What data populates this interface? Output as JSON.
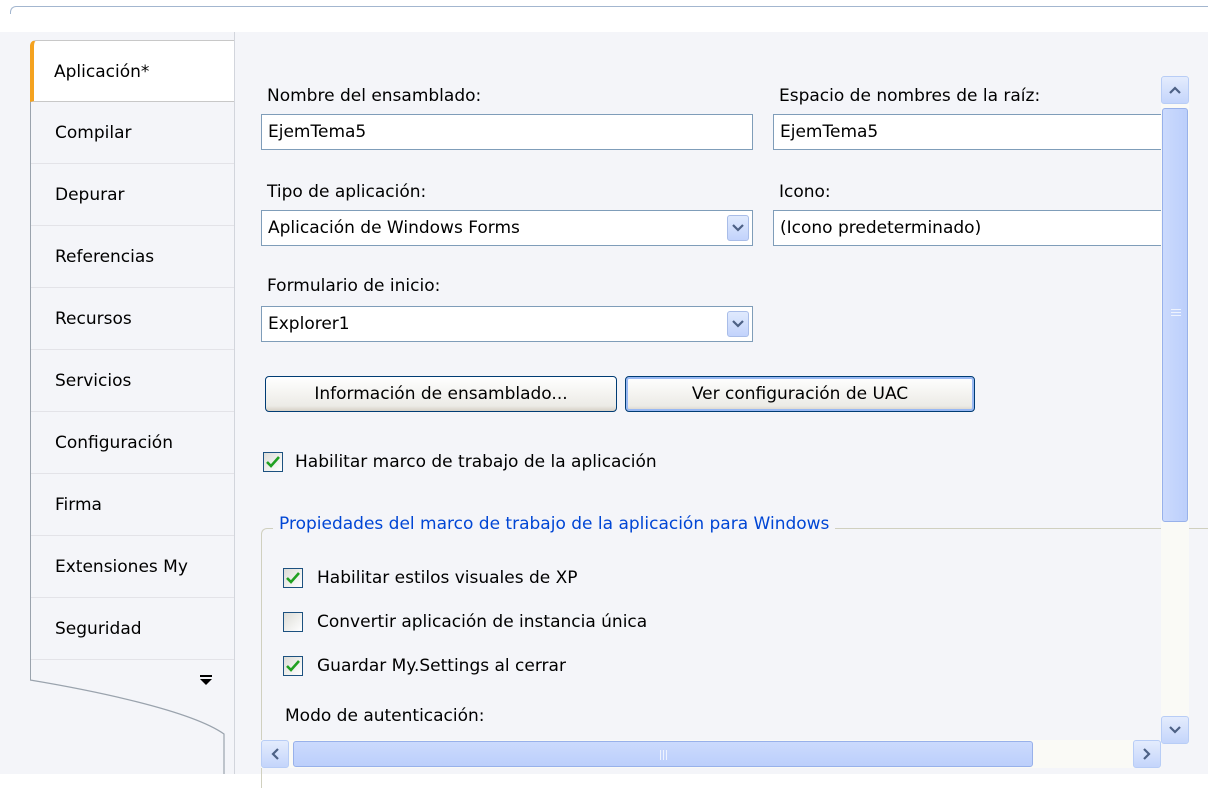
{
  "tabs": [
    {
      "label": "Aplicación*",
      "active": true
    },
    {
      "label": "Compilar"
    },
    {
      "label": "Depurar"
    },
    {
      "label": "Referencias"
    },
    {
      "label": "Recursos"
    },
    {
      "label": "Servicios"
    },
    {
      "label": "Configuración"
    },
    {
      "label": "Firma"
    },
    {
      "label": "Extensiones My"
    },
    {
      "label": "Seguridad"
    }
  ],
  "form": {
    "assembly_name_label": "Nombre del ensamblado:",
    "assembly_name_value": "EjemTema5",
    "root_namespace_label": "Espacio de nombres de la raíz:",
    "root_namespace_value": "EjemTema5",
    "app_type_label": "Tipo de aplicación:",
    "app_type_value": "Aplicación de Windows Forms",
    "icon_label": "Icono:",
    "icon_value": "(Icono predeterminado)",
    "startup_form_label": "Formulario de inicio:",
    "startup_form_value": "Explorer1",
    "assembly_info_button": "Información de ensamblado...",
    "uac_button": "Ver configuración de UAC",
    "enable_framework_label": "Habilitar marco de trabajo de la aplicación",
    "enable_framework_checked": true
  },
  "framework_group": {
    "title": "Propiedades del marco de trabajo de la aplicación para Windows",
    "options": [
      {
        "label": "Habilitar estilos visuales de XP",
        "checked": true
      },
      {
        "label": "Convertir aplicación de instancia única",
        "checked": false
      },
      {
        "label": "Guardar My.Settings al cerrar",
        "checked": true
      }
    ],
    "auth_mode_label": "Modo de autenticación:"
  },
  "colors": {
    "accent_tab": "#f4a21f",
    "group_title": "#0046d5",
    "check_mark": "#21a121"
  }
}
